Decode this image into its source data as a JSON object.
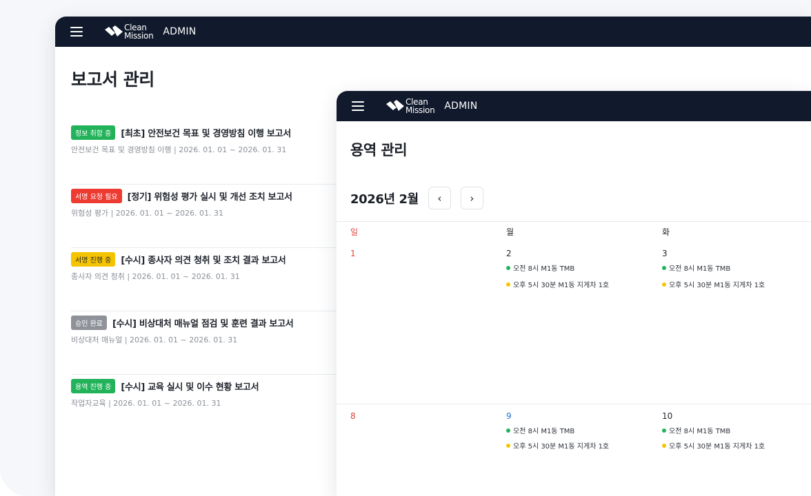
{
  "brand": {
    "logo_line1": "Clean",
    "logo_line2": "Mission",
    "admin_label": "ADMIN"
  },
  "reports_page": {
    "title": "보고서 관리",
    "reports": [
      {
        "badge": "정보 취합 중",
        "badge_color": "#22b35a",
        "title": "[최초] 안전보건 목표 및 경영방침 이행 보고서",
        "subtitle": "안전보건 목표 및 경영방침 이행 | 2026. 01. 01 ~ 2026. 01. 31"
      },
      {
        "badge": "서명 요청 필요",
        "badge_color": "#ee3b32",
        "title": "[정기] 위험성 평가 실시 및 개선 조치 보고서",
        "subtitle": "위험성 평가 | 2026. 01. 01 ~ 2026. 01. 31"
      },
      {
        "badge": "서명 진행 중",
        "badge_color": "#f5c400",
        "badge_text_color": "#2b2b2b",
        "title": "[수시] 종사자 의견 청취 및 조치 결과 보고서",
        "subtitle": "종사자 의견 청취   |  2026. 01. 01 ~ 2026. 01. 31"
      },
      {
        "badge": "승인 완료",
        "badge_color": "#8f9399",
        "title": "[수시] 비상대처 매뉴얼 점검 및 훈련 결과 보고서",
        "subtitle": "비상대처 매뉴얼   |  2026. 01. 01 ~ 2026. 01. 31"
      },
      {
        "badge": "용역 진행 중",
        "badge_color": "#22b35a",
        "title": "[수시] 교육 실시 및 이수 현황 보고서",
        "subtitle": "작업자교육   |  2026. 01. 01 ~ 2026. 01. 31"
      }
    ]
  },
  "service_page": {
    "title": "용역 관리",
    "month_label": "2026년 2월",
    "prev_icon": "chevron-left-icon",
    "next_icon": "chevron-right-icon",
    "prev_glyph": "‹",
    "next_glyph": "›",
    "weekdays": [
      "일",
      "월",
      "화"
    ],
    "weeks": [
      {
        "days": [
          {
            "num": "1",
            "type": "sun",
            "events": []
          },
          {
            "num": "2",
            "type": "normal",
            "events": [
              {
                "color": "#22b35a",
                "text": "오전 8시 M1동 TMB"
              },
              {
                "color": "#f5c400",
                "text": "오후 5시 30분 M1동 지게차 1호"
              }
            ]
          },
          {
            "num": "3",
            "type": "normal",
            "events": [
              {
                "color": "#22b35a",
                "text": "오전 8시 M1동 TMB"
              },
              {
                "color": "#f5c400",
                "text": "오후 5시 30분 M1동 지게차 1호"
              }
            ]
          }
        ]
      },
      {
        "days": [
          {
            "num": "8",
            "type": "sun",
            "events": []
          },
          {
            "num": "9",
            "type": "holiday",
            "events": [
              {
                "color": "#22b35a",
                "text": "오전 8시 M1동 TMB"
              },
              {
                "color": "#f5c400",
                "text": "오후 5시 30분 M1동 지게차 1호"
              }
            ]
          },
          {
            "num": "10",
            "type": "normal",
            "events": [
              {
                "color": "#22b35a",
                "text": "오전 8시 M1동 TMB"
              },
              {
                "color": "#f5c400",
                "text": "오후 5시 30분 M1동 지게차 1호"
              }
            ]
          }
        ]
      }
    ]
  },
  "colors": {
    "topbar": "#111a2c",
    "sunday": "#e0443a",
    "holiday": "#1d73c9"
  }
}
